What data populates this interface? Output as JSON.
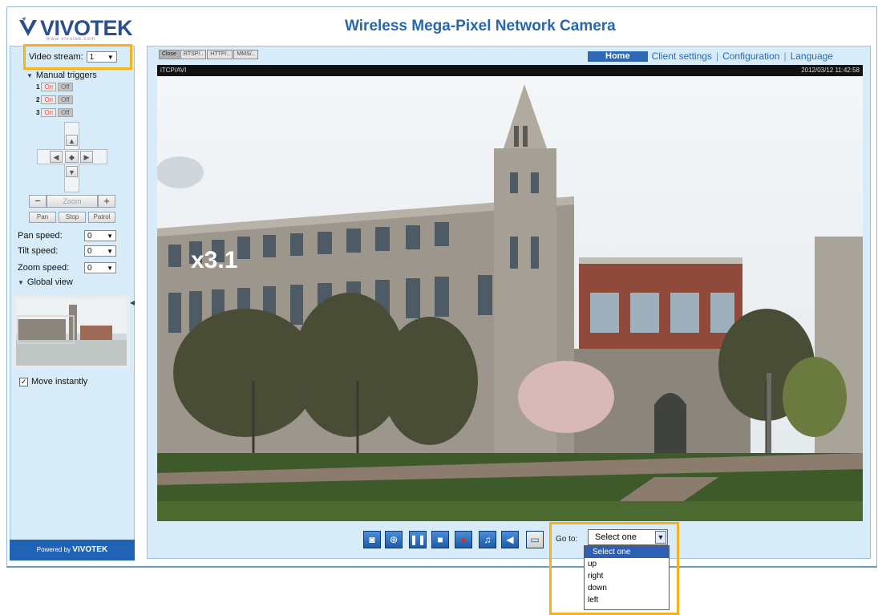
{
  "header": {
    "logo_text": "VIVOTEK",
    "logo_sub": "www.vivotek.com",
    "title": "Wireless Mega-Pixel Network Camera"
  },
  "nav": {
    "home": "Home",
    "client_settings": "Client settings",
    "configuration": "Configuration",
    "language": "Language"
  },
  "protocols": [
    "Close",
    "RTSP/..",
    "HTTP/..",
    "MMS/.."
  ],
  "video": {
    "label_left": "iTCP/AVI",
    "timestamp": "2012/03/12 11:42:58",
    "zoom_overlay": "x3.1"
  },
  "sidebar": {
    "video_stream_label": "Video stream:",
    "video_stream_value": "1",
    "manual_triggers_label": "Manual triggers",
    "triggers": [
      {
        "num": "1",
        "on": "On",
        "off": "Off"
      },
      {
        "num": "2",
        "on": "On",
        "off": "Off"
      },
      {
        "num": "3",
        "on": "On",
        "off": "Off"
      }
    ],
    "zoom_label": "Zoom",
    "pan_label": "Pan",
    "stop_label": "Stop",
    "patrol_label": "Patrol",
    "pan_speed_label": "Pan speed:",
    "pan_speed_value": "0",
    "tilt_speed_label": "Tilt speed:",
    "tilt_speed_value": "0",
    "zoom_speed_label": "Zoom speed:",
    "zoom_speed_value": "0",
    "global_view_label": "Global view",
    "move_instantly_label": "Move instantly",
    "powered_by": "Powered by",
    "powered_brand": "VIVOTEK"
  },
  "controls": {
    "goto_label": "Go to:",
    "selected": "Select one",
    "options": [
      "Select one",
      "up",
      "right",
      "down",
      "left"
    ]
  },
  "colors": {
    "accent": "#2766b0",
    "highlight": "#f2b31c",
    "panel": "#d7ebf9"
  },
  "icons": {
    "control_buttons": [
      "camera-icon",
      "zoom-icon",
      "pause-icon",
      "stop-icon",
      "record-icon",
      "volume-icon",
      "speaker-icon",
      "fullscreen-icon"
    ]
  }
}
